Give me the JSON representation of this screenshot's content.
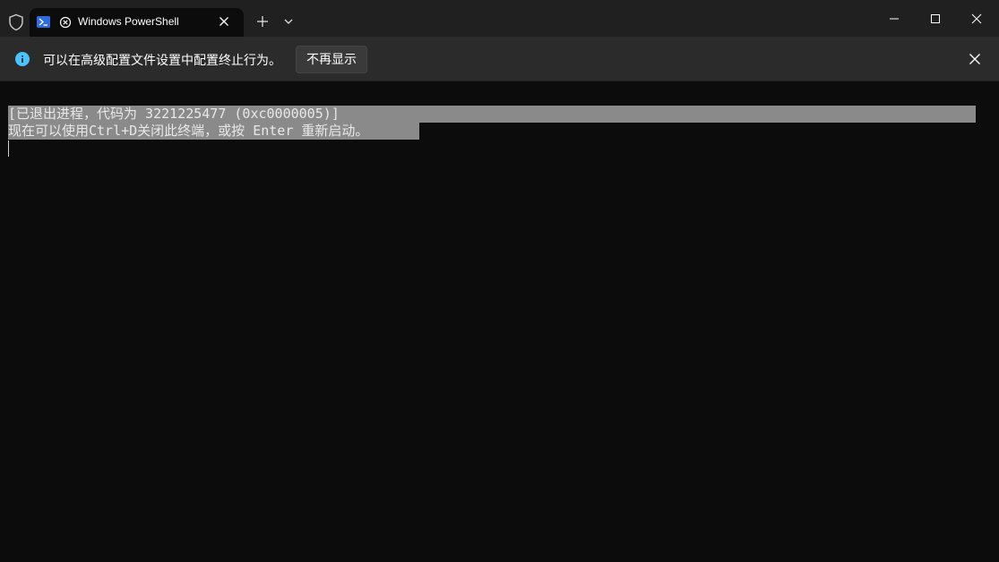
{
  "titlebar": {
    "tab_title": "Windows PowerShell",
    "icons": {
      "shield": "shield-icon",
      "powershell": "powershell-icon",
      "tab_status": "circle-x-icon",
      "tab_close": "close-icon",
      "new_tab": "plus-icon",
      "dropdown": "chevron-down-icon",
      "minimize": "minimize-icon",
      "maximize": "maximize-icon",
      "close": "close-icon"
    }
  },
  "infobar": {
    "message": "可以在高级配置文件设置中配置终止行为。",
    "dismiss_button": "不再显示",
    "icons": {
      "info": "info-icon",
      "close": "close-icon"
    }
  },
  "terminal": {
    "lines": [
      "[已退出进程，代码为 3221225477 (0xc0000005)]",
      "现在可以使用Ctrl+D关闭此终端，或按 Enter 重新启动。"
    ]
  },
  "colors": {
    "titlebar_bg": "#202020",
    "tab_bg": "#0c0c0c",
    "infobar_bg": "#2b2b2b",
    "info_accent": "#4cc2ff",
    "terminal_bg": "#0c0c0c",
    "selection_bg": "#8a8a8a"
  }
}
